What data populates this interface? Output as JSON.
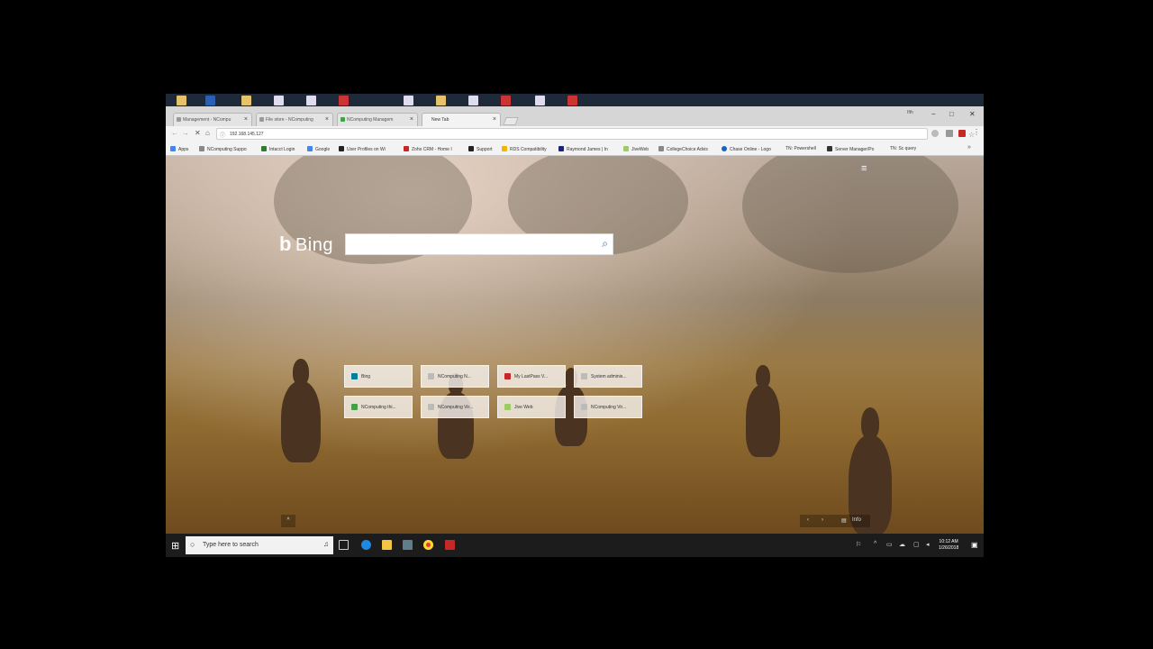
{
  "browser": {
    "tabs": [
      {
        "label": "Management - NCompu",
        "active": false
      },
      {
        "label": "File store - NComputing",
        "active": false
      },
      {
        "label": "NComputing Managem",
        "active": false
      },
      {
        "label": "New Tab",
        "active": true
      }
    ],
    "profile_label": "Ifth",
    "address": "192.168.145.127",
    "bookmarks": [
      {
        "label": "Apps",
        "icon": "apps-grid-icon",
        "color": "#4285f4"
      },
      {
        "label": "NComputing Suppo",
        "icon": "page-icon",
        "color": "#888888"
      },
      {
        "label": "Intacct Login",
        "icon": "intacct-icon",
        "color": "#2e7d32"
      },
      {
        "label": "Google",
        "icon": "google-icon",
        "color": "#4285f4"
      },
      {
        "label": "User Profiles on Wi",
        "icon": "page-icon",
        "color": "#222222"
      },
      {
        "label": "Zoho CRM - Home I",
        "icon": "zoho-icon",
        "color": "#c62828"
      },
      {
        "label": "Support",
        "icon": "support-icon",
        "color": "#222222"
      },
      {
        "label": "RDS Compatibility",
        "icon": "folder-icon",
        "color": "#f4b400"
      },
      {
        "label": "Raymond James | In",
        "icon": "rj-icon",
        "color": "#1a237e"
      },
      {
        "label": "JiveWeb",
        "icon": "jive-icon",
        "color": "#9ccc65"
      },
      {
        "label": "CollegeChoice Advis",
        "icon": "page-icon",
        "color": "#888888"
      },
      {
        "label": "Chase Online - Logo",
        "icon": "chase-icon",
        "color": "#1565c0"
      },
      {
        "label": "TN: Powershell",
        "icon": "tn-icon",
        "color": "#333333"
      },
      {
        "label": "Server Manager/Po",
        "icon": "tn-icon",
        "color": "#333333"
      },
      {
        "label": "TN: Sc query",
        "icon": "tn-icon",
        "color": "#333333"
      }
    ]
  },
  "page": {
    "brand": "Bing",
    "tiles": [
      {
        "label": "Bing",
        "icon": "bing-icon",
        "color": "#00809d"
      },
      {
        "label": "NComputing N...",
        "icon": "page-icon",
        "color": "#888888"
      },
      {
        "label": "My LastPass V...",
        "icon": "lastpass-icon",
        "color": "#c62828"
      },
      {
        "label": "System adminis...",
        "icon": "page-icon",
        "color": "#888888"
      },
      {
        "label": "NComputing thi...",
        "icon": "ncomputing-icon",
        "color": "#43a047"
      },
      {
        "label": "NComputing Vir...",
        "icon": "page-icon",
        "color": "#888888"
      },
      {
        "label": "Jive Web",
        "icon": "jive-icon",
        "color": "#9ccc65"
      },
      {
        "label": "NComputing Vir...",
        "icon": "page-icon",
        "color": "#888888"
      }
    ],
    "info_label": "Info"
  },
  "taskbar": {
    "search_placeholder": "Type here to search",
    "time": "10:12 AM",
    "date": "1/26/2018"
  }
}
